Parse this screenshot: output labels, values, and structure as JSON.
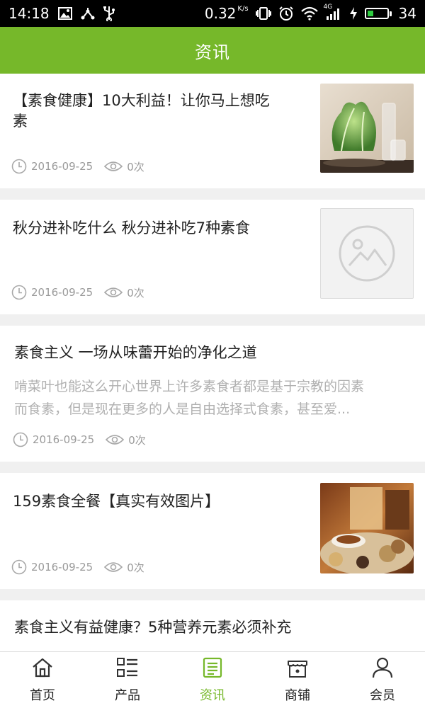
{
  "status_bar": {
    "time": "14:18",
    "speed": "0.32",
    "speed_unit": "K/s",
    "network": "4G",
    "battery": "34",
    "battery_level": 0.34
  },
  "header": {
    "title": "资讯"
  },
  "colors": {
    "brand": "#76b82a",
    "meta": "#9a9a9a",
    "desc": "#b0b0b0"
  },
  "articles": [
    {
      "title_line1": "【素食健康】10大利益！让你马上想吃",
      "title_line2": "素",
      "date": "2016-09-25",
      "views": "0次",
      "thumbnail": "lettuce-photo"
    },
    {
      "title": "秋分进补吃什么 秋分进补吃7种素食",
      "date": "2016-09-25",
      "views": "0次",
      "thumbnail": "placeholder-image-icon"
    },
    {
      "title": "素食主义 一场从味蕾开始的净化之道",
      "desc_line1": "啃菜叶也能这么开心世界上许多素食者都是基于宗教的因素",
      "desc_line2": "而食素，但是现在更多的人是自由选择式食素，甚至爱...",
      "date": "2016-09-25",
      "views": "0次"
    },
    {
      "title": "159素食全餐【真实有效图片】",
      "date": "2016-09-25",
      "views": "0次",
      "thumbnail": "coffee-grains-photo"
    },
    {
      "title": "素食主义有益健康？5种营养元素必须补充"
    }
  ],
  "nav": [
    {
      "label": "首页",
      "icon": "home-icon"
    },
    {
      "label": "产品",
      "icon": "grid-list-icon"
    },
    {
      "label": "资讯",
      "icon": "news-icon",
      "active": true
    },
    {
      "label": "商铺",
      "icon": "shop-icon"
    },
    {
      "label": "会员",
      "icon": "user-icon"
    }
  ]
}
